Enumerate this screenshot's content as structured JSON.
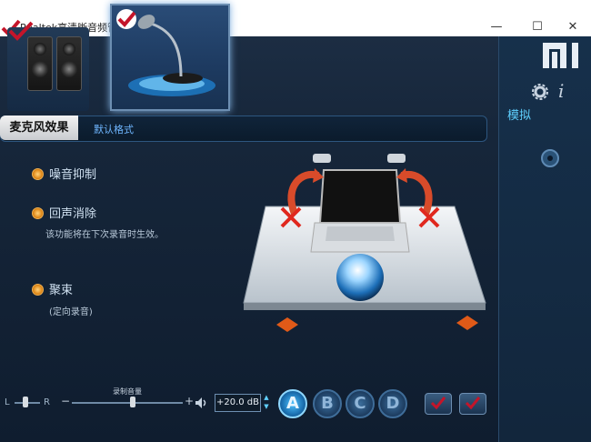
{
  "window": {
    "title": "Realtek高清晰音频管理器"
  },
  "tabs": {
    "active": "麦克风效果",
    "default_format": "默认格式"
  },
  "options": [
    {
      "label": "噪音抑制",
      "sub": ""
    },
    {
      "label": "回声消除",
      "sub": "该功能将在下次录音时生效。"
    },
    {
      "label": "聚束",
      "sub": "(定向录音)"
    }
  ],
  "controls": {
    "balance_left": "L",
    "balance_right": "R",
    "volume_label": "录制音量",
    "volume_minus": "−",
    "volume_plus": "+",
    "volume_level_fraction": 0.55,
    "gain_value": "+20.0 dB",
    "buttons": [
      "A",
      "B",
      "C",
      "D"
    ]
  },
  "side": {
    "analog_label": "模拟"
  },
  "icons": {
    "logo": "mi-logo-icon",
    "settings": "gear-icon",
    "info": "info-icon",
    "jack": "audio-jack-icon"
  },
  "colors": {
    "accent": "#4fc4ff",
    "radio": "#e08a1a",
    "tab_text": "#6fb6ff"
  }
}
